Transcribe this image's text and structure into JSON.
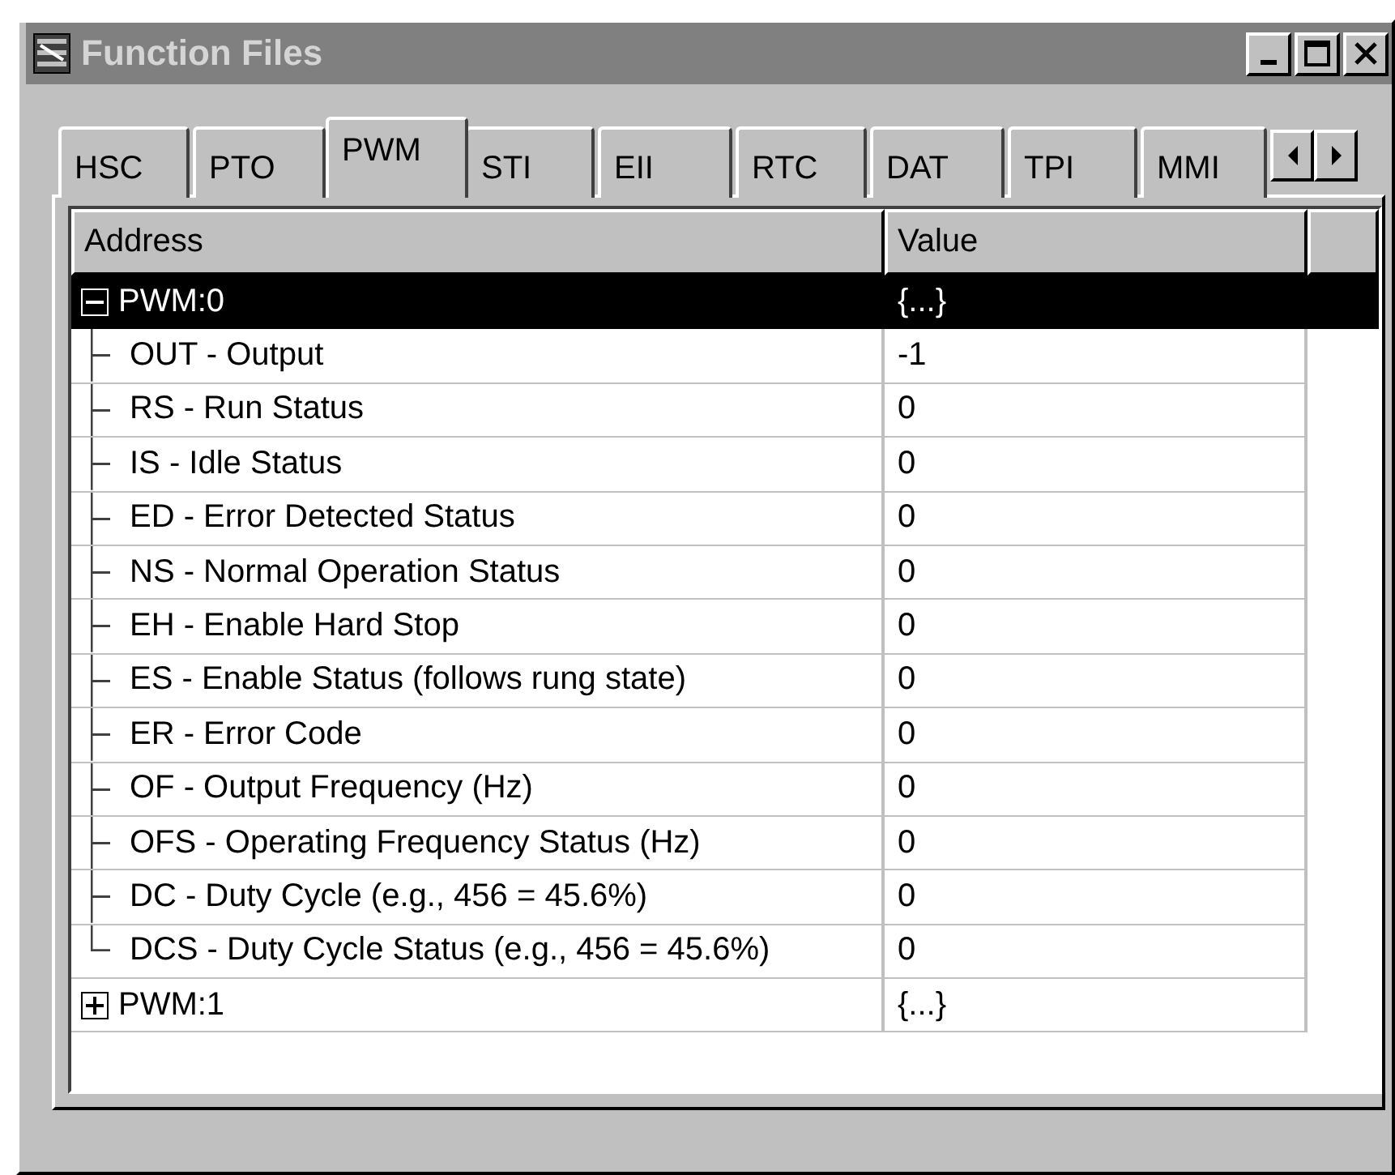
{
  "window": {
    "title": "Function Files"
  },
  "tabs": [
    {
      "label": "HSC",
      "selected": false
    },
    {
      "label": "PTO",
      "selected": false
    },
    {
      "label": "PWM",
      "selected": true
    },
    {
      "label": "STI",
      "selected": false
    },
    {
      "label": "EII",
      "selected": false
    },
    {
      "label": "RTC",
      "selected": false
    },
    {
      "label": "DAT",
      "selected": false
    },
    {
      "label": "TPI",
      "selected": false
    },
    {
      "label": "MMI",
      "selected": false
    }
  ],
  "table": {
    "columns": [
      "Address",
      "Value"
    ],
    "rows": [
      {
        "address": "PWM:0",
        "value": "{...}",
        "expanded": true,
        "selected": true,
        "children": [
          {
            "address": "OUT - Output",
            "value": "-1",
            "selected": false
          },
          {
            "address": "RS - Run Status",
            "value": "0",
            "selected": false
          },
          {
            "address": "IS - Idle Status",
            "value": "0",
            "selected": false
          },
          {
            "address": "ED - Error Detected Status",
            "value": "0",
            "selected": false
          },
          {
            "address": "NS - Normal Operation Status",
            "value": "0",
            "selected": false
          },
          {
            "address": "EH - Enable Hard Stop",
            "value": "0",
            "selected": false
          },
          {
            "address": "ES - Enable Status (follows rung state)",
            "value": "0",
            "selected": false
          },
          {
            "address": "ER - Error Code",
            "value": "0",
            "selected": false
          },
          {
            "address": "OF - Output Frequency (Hz)",
            "value": "0",
            "selected": false
          },
          {
            "address": "OFS - Operating Frequency Status (Hz)",
            "value": "0",
            "selected": false
          },
          {
            "address": "DC - Duty Cycle (e.g., 456 = 45.6%)",
            "value": "0",
            "selected": false
          },
          {
            "address": "DCS - Duty Cycle Status (e.g., 456 = 45.6%)",
            "value": "0",
            "selected": false
          }
        ]
      },
      {
        "address": "PWM:1",
        "value": "{...}",
        "expanded": false,
        "selected": false
      }
    ]
  }
}
